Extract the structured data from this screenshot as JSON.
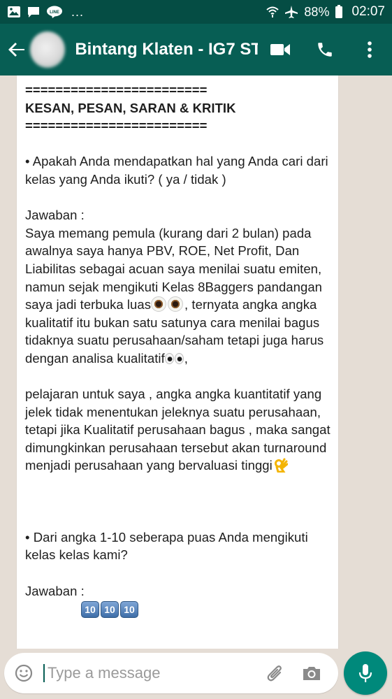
{
  "status_bar": {
    "dots": "...",
    "battery": "88%",
    "time": "02:07"
  },
  "app_bar": {
    "title": "Bintang Klaten - IG7 ST..."
  },
  "message": {
    "separator": "========================",
    "heading": "KESAN, PESAN, SARAN & KRITIK",
    "q1_line1": "• Apakah Anda mendapatkan hal yang Anda cari dari",
    "q1_line2": "kelas yang Anda ikuti? ( ya / tidak )",
    "answer_label": "Jawaban :",
    "a1_line1": "Saya memang pemula (kurang dari 2 bulan) pada",
    "a1_line2": "awalnya saya hanya PBV, ROE, Net Profit, Dan",
    "a1_line3": "Liabilitas sebagai acuan saya menilai suatu emiten,",
    "a1_line4": "namun sejak mengikuti Kelas 8Baggers pandangan",
    "a1_line5a": "saya jadi terbuka luas",
    "a1_line5b": ",  ternyata angka angka",
    "a1_line6": "kualitatif itu bukan satu satunya cara menilai bagus",
    "a1_line7": "tidaknya suatu perusahaan/saham tetapi juga harus",
    "a1_line8a": "dengan analisa kualitatif",
    "a1_line8b": ",",
    "a2_line1": "pelajaran untuk saya , angka angka kuantitatif yang",
    "a2_line2": "jelek tidak menentukan jeleknya suatu perusahaan,",
    "a2_line3": "tetapi jika Kualitatif perusahaan bagus , maka sangat",
    "a2_line4": "dimungkinkan perusahaan tersebut akan turnaround",
    "a2_line5": "menjadi perusahaan yang bervaluasi tinggi",
    "q2_line1": "• Dari angka 1-10 seberapa puas Anda mengikuti",
    "q2_line2": "kelas kelas kami?",
    "answer2_label": "Jawaban :",
    "rating_keycaps": [
      "10",
      "10",
      "10"
    ]
  },
  "input_bar": {
    "placeholder": "Type a message"
  },
  "icons": {
    "status": [
      "image-icon",
      "chat-icon",
      "line-app-icon",
      "wifi-icon",
      "airplane-icon",
      "battery-icon"
    ],
    "app_bar": [
      "back-arrow-icon",
      "video-call-icon",
      "phone-icon",
      "more-vert-icon"
    ],
    "input": [
      "emoji-icon",
      "attach-icon",
      "camera-icon",
      "mic-icon"
    ]
  },
  "colors": {
    "status_bar": "#054d44",
    "app_bar": "#075e54",
    "chat_background": "#e5ddd5",
    "mic_button": "#00897b"
  }
}
